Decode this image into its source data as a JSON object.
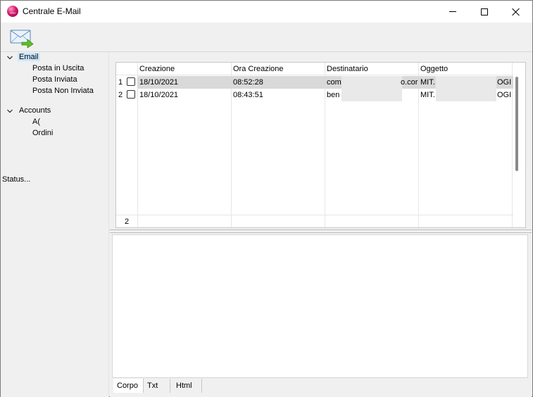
{
  "window": {
    "title": "Centrale E-Mail"
  },
  "tree": {
    "email": {
      "label": "Email",
      "children": [
        "Posta in Uscita",
        "Posta Inviata",
        "Posta Non Inviata"
      ]
    },
    "accounts": {
      "label": "Accounts",
      "children": [
        "A(",
        "Ordini"
      ]
    }
  },
  "status": "Status...",
  "grid": {
    "columns": [
      "Creazione",
      "Ora Creazione",
      "Destinatario",
      "Oggetto"
    ],
    "rows": [
      {
        "num": "1",
        "creazione": "18/10/2021",
        "ora": "08:52:28",
        "dest_start": "com",
        "dest_end": "o.cor",
        "obj_start": "MIT.",
        "obj_end": "OGI"
      },
      {
        "num": "2",
        "creazione": "18/10/2021",
        "ora": "08:43:51",
        "dest_start": "ben",
        "dest_end": "",
        "obj_start": "MIT.",
        "obj_end": "OGI"
      }
    ],
    "footer_count": "2"
  },
  "tabs": [
    "Corpo",
    "Txt",
    "Html"
  ]
}
